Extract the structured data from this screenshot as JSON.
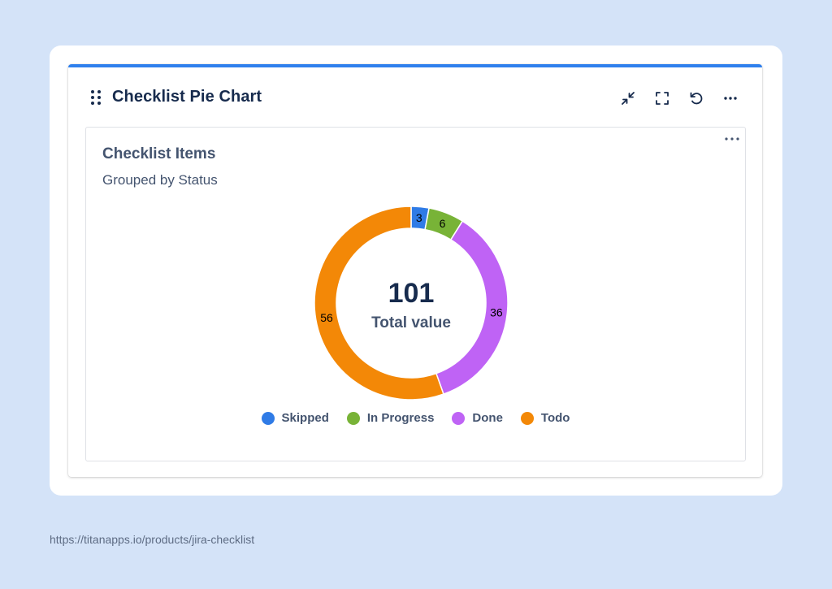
{
  "gadget": {
    "title": "Checklist Pie Chart",
    "toolbar": [
      "minimize-icon",
      "fullscreen-icon",
      "refresh-icon",
      "more-icon"
    ]
  },
  "panel": {
    "title": "Checklist Items",
    "subtitle": "Grouped by Status",
    "center_value": "101",
    "center_label": "Total value"
  },
  "colors": {
    "accent_bar": "#2f80ed",
    "background": "#d4e3f8"
  },
  "chart_data": {
    "type": "pie",
    "total": 101,
    "categories": [
      "Skipped",
      "In Progress",
      "Done",
      "Todo"
    ],
    "values": [
      3,
      6,
      36,
      56
    ],
    "colors": [
      "#2f7be6",
      "#78b337",
      "#bf63f5",
      "#f38807"
    ],
    "legend_position": "bottom"
  },
  "footer": {
    "url": "https://titanapps.io/products/jira-checklist"
  }
}
